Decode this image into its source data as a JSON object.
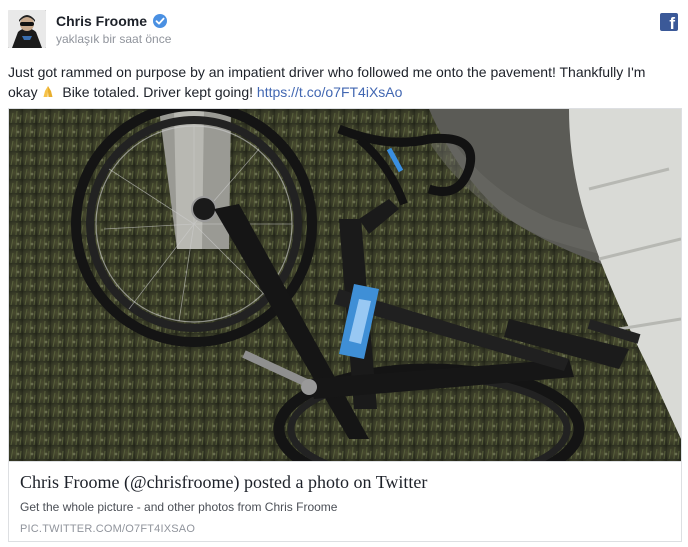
{
  "author": {
    "name": "Chris Froome",
    "verified": true
  },
  "timestamp": "yaklaşık bir saat önce",
  "post": {
    "text": "Just got rammed on purpose by an impatient driver who followed me onto the pavement! Thankfully I'm okay",
    "text_after_emoji": "Bike totaled. Driver kept going!",
    "link": "https://t.co/o7FT4iXsAo"
  },
  "card": {
    "title": "Chris Froome (@chrisfroome) posted a photo on Twitter",
    "description": "Get the whole picture - and other photos from Chris Froome",
    "domain": "PIC.TWITTER.COM/O7FT4IXSAO"
  },
  "icons": {
    "network": "facebook-icon",
    "verified": "verified-badge-icon",
    "emoji": "folded-hands-emoji-icon"
  },
  "colors": {
    "link": "#4267b2",
    "muted": "#90949c",
    "facebook": "#3b5998",
    "verified": "#4a90e2"
  }
}
